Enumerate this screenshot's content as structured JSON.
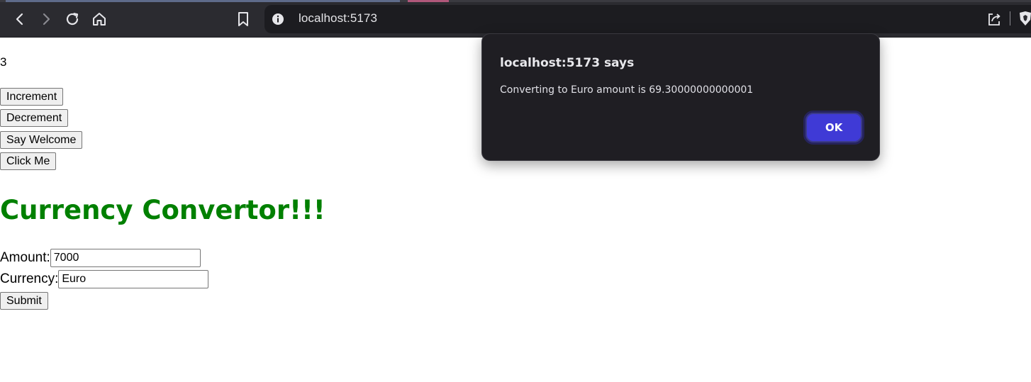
{
  "browser": {
    "url": "localhost:5173",
    "icons": [
      "back-icon",
      "forward-icon",
      "reload-icon",
      "home-icon",
      "bookmark-icon",
      "info-icon",
      "share-icon",
      "brave-shield-icon"
    ]
  },
  "page": {
    "count": "3",
    "buttons": {
      "increment": "Increment",
      "decrement": "Decrement",
      "say_welcome": "Say Welcome",
      "click_me": "Click Me"
    },
    "heading": "Currency Convertor!!!",
    "heading_color": "#008000",
    "form": {
      "amount_label": "Amount:",
      "amount_value": "7000",
      "currency_label": "Currency:",
      "currency_value": "Euro",
      "submit_label": "Submit"
    }
  },
  "dialog": {
    "title": "localhost:5173 says",
    "message": "Converting to Euro amount is 69.30000000000001",
    "ok_label": "OK",
    "ok_color": "#3f3ad6"
  }
}
